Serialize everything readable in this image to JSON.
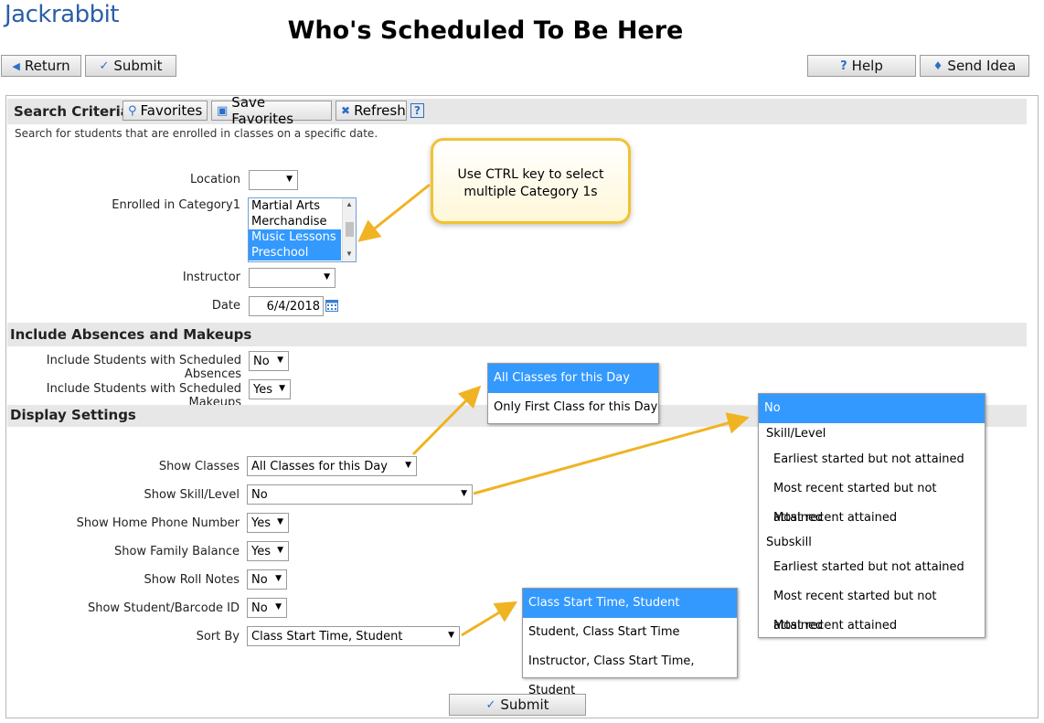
{
  "app": {
    "logo": "Jackrabbit",
    "title": "Who's Scheduled To Be Here"
  },
  "toolbar": {
    "return_label": "Return",
    "submit_label": "Submit",
    "help_label": "Help",
    "send_idea_label": "Send Idea"
  },
  "search": {
    "title": "Search Criteria",
    "favorites_label": "Favorites",
    "save_favorites_label": "Save Favorites",
    "refresh_label": "Refresh",
    "help_icon": "?",
    "description": "Search for students that are enrolled in classes on a specific date.",
    "location_label": "Location",
    "location_value": "",
    "category_label": "Enrolled in Category1",
    "category_options": [
      {
        "label": "Martial Arts",
        "selected": false
      },
      {
        "label": "Merchandise",
        "selected": false
      },
      {
        "label": "Music Lessons",
        "selected": true
      },
      {
        "label": "Preschool",
        "selected": true
      }
    ],
    "instructor_label": "Instructor",
    "instructor_value": "",
    "date_label": "Date",
    "date_value": "6/4/2018"
  },
  "callout": {
    "text": "Use CTRL key to select multiple Category 1s"
  },
  "absences": {
    "title": "Include Absences and Makeups",
    "absences_label": "Include Students with Scheduled Absences",
    "absences_value": "No",
    "makeups_label": "Include Students with Scheduled Makeups",
    "makeups_value": "Yes"
  },
  "display": {
    "title": "Display Settings",
    "show_classes_label": "Show Classes",
    "show_classes_value": "All Classes for this Day",
    "show_skill_label": "Show Skill/Level",
    "show_skill_value": "No",
    "show_phone_label": "Show Home Phone Number",
    "show_phone_value": "Yes",
    "show_balance_label": "Show Family Balance",
    "show_balance_value": "Yes",
    "show_notes_label": "Show Roll Notes",
    "show_notes_value": "No",
    "show_barcode_label": "Show Student/Barcode ID",
    "show_barcode_value": "No",
    "sort_by_label": "Sort By",
    "sort_by_value": "Class Start Time, Student"
  },
  "classes_dropdown": [
    "All Classes for this Day",
    "Only First Class for this Day"
  ],
  "skill_dropdown": {
    "first": "No",
    "group1": "Skill/Level",
    "group1_items": [
      "Earliest started but not attained",
      "Most recent started but not attained",
      "Most recent attained"
    ],
    "group2": "Subskill",
    "group2_items": [
      "Earliest started but not attained",
      "Most recent started but not attained",
      "Most recent attained"
    ]
  },
  "sort_dropdown": [
    "Class Start Time, Student",
    "Student, Class Start Time",
    "Instructor, Class Start Time, Student"
  ],
  "footer": {
    "submit_label": "Submit"
  },
  "icons": {
    "return": "left-triangle-icon",
    "submit": "checkmark-icon",
    "help": "question-icon",
    "send_idea": "lightbulb-icon",
    "favorites": "magnifier-icon",
    "save": "floppy-disk-icon",
    "refresh": "x-icon",
    "calendar": "calendar-icon"
  },
  "colors": {
    "accent": "#3399ff",
    "callout_border": "#f1c232",
    "arrow": "#f0b323",
    "logo": "#2b5fa8"
  }
}
